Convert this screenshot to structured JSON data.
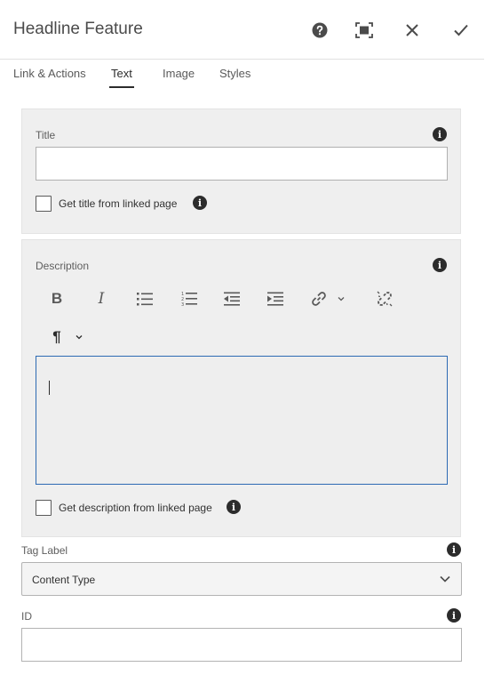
{
  "dialog": {
    "title": "Headline Feature"
  },
  "tabs": [
    {
      "label": "Link & Actions"
    },
    {
      "label": "Text"
    },
    {
      "label": "Image"
    },
    {
      "label": "Styles"
    }
  ],
  "title_section": {
    "label": "Title",
    "value": "",
    "checkbox_label": "Get title from linked page"
  },
  "description_section": {
    "label": "Description",
    "value": "",
    "checkbox_label": "Get description from linked page"
  },
  "tag_label": {
    "label": "Tag Label",
    "selected": "Content Type"
  },
  "id_field": {
    "label": "ID",
    "value": ""
  },
  "colors": {
    "accent": "#2d6ab3",
    "panel": "#efefef",
    "text": "#323232"
  }
}
